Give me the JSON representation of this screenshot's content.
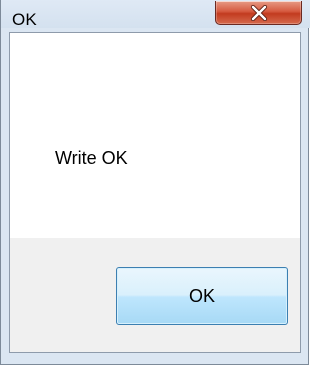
{
  "window": {
    "title": "OK"
  },
  "icons": {
    "close": "close-icon"
  },
  "dialog": {
    "message": "Write OK",
    "ok_label": "OK"
  },
  "colors": {
    "title_bar": "#d8e4f1",
    "close_button": "#c7432a",
    "ok_button_border": "#3c7fb1",
    "footer": "#f0f0f0"
  }
}
